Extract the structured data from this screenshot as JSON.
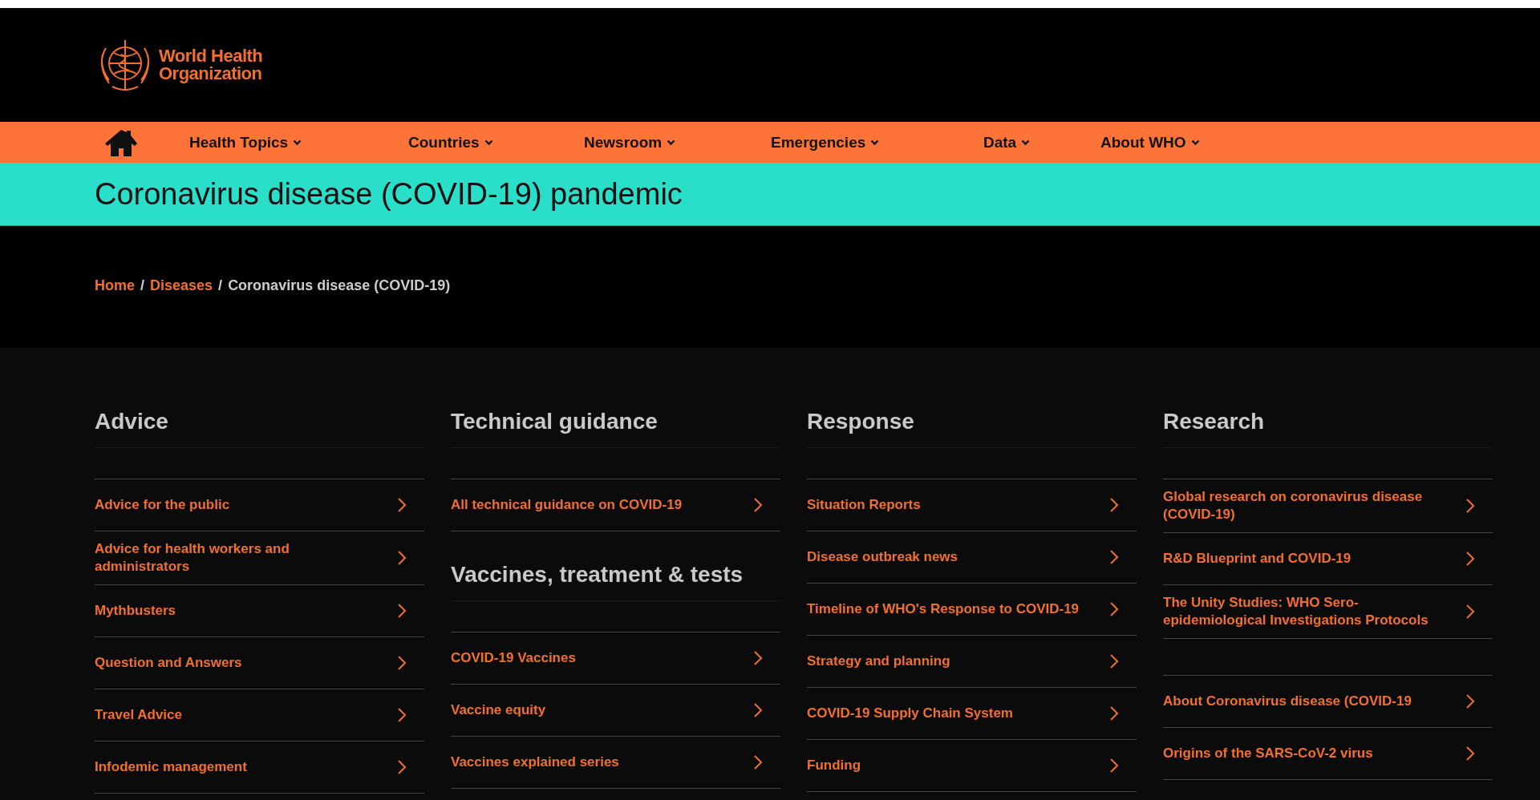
{
  "header": {
    "logo_text": [
      "World Health",
      "Organization"
    ]
  },
  "nav": {
    "items": [
      {
        "label": "Health Topics"
      },
      {
        "label": "Countries"
      },
      {
        "label": "Newsroom"
      },
      {
        "label": "Emergencies"
      },
      {
        "label": "Data"
      },
      {
        "label": "About WHO"
      }
    ]
  },
  "banner": {
    "title": "Coronavirus disease (COVID-19) pandemic"
  },
  "breadcrumb_separator": "/",
  "breadcrumb": [
    {
      "label": "Home",
      "kind": "link"
    },
    {
      "label": "Diseases",
      "kind": "link"
    },
    {
      "label": "Coronavirus disease (COVID-19)",
      "kind": "current"
    }
  ],
  "columns": [
    {
      "sections": [
        {
          "title": "Advice",
          "links": [
            "Advice for the public",
            "Advice for health workers and administrators",
            "Mythbusters",
            "Question and Answers",
            "Travel Advice",
            "Infodemic management"
          ]
        }
      ]
    },
    {
      "sections": [
        {
          "title": "Technical guidance",
          "links": [
            "All technical guidance on COVID-19"
          ]
        },
        {
          "title": "Vaccines, treatment & tests",
          "links": [
            "COVID-19 Vaccines",
            "Vaccine equity",
            "Vaccines explained series"
          ]
        }
      ]
    },
    {
      "sections": [
        {
          "title": "Response",
          "links": [
            "Situation Reports",
            "Disease outbreak news",
            "Timeline of WHO's Response to COVID-19",
            "Strategy and planning",
            "COVID-19 Supply Chain System",
            "Funding"
          ]
        }
      ]
    },
    {
      "sections": [
        {
          "title": "Research",
          "links": [
            "Global research on coronavirus disease (COVID-19)",
            "R&D Blueprint and COVID-19",
            "The Unity Studies: WHO Sero-epidemiological Investigations Protocols"
          ]
        },
        {
          "links": [
            "About Coronavirus disease (COVID-19",
            "Origins of the SARS-CoV-2 virus"
          ]
        }
      ]
    }
  ]
}
